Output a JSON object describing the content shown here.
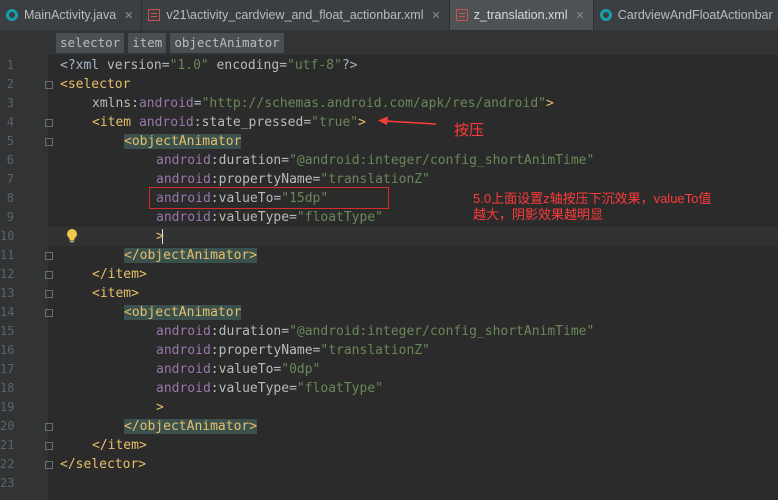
{
  "tabs": [
    {
      "label": "MainActivity.java",
      "icon": "java-class-icon",
      "active": false
    },
    {
      "label": "v21\\activity_cardview_and_float_actionbar.xml",
      "icon": "xml-file-icon",
      "active": false
    },
    {
      "label": "z_translation.xml",
      "icon": "xml-file-icon",
      "active": true
    },
    {
      "label": "CardviewAndFloatActionbar",
      "icon": "java-class-icon",
      "active": false
    }
  ],
  "breadcrumbs": [
    "selector",
    "item",
    "objectAnimator"
  ],
  "line_numbers": [
    "1",
    "2",
    "3",
    "4",
    "5",
    "6",
    "7",
    "8",
    "9",
    "10",
    "11",
    "12",
    "13",
    "14",
    "15",
    "16",
    "17",
    "18",
    "19",
    "20",
    "21",
    "22",
    "23"
  ],
  "code": {
    "l1": {
      "a": "<?xml ",
      "b": "version",
      "c": "=",
      "d": "\"1.0\"",
      "e": " encoding",
      "f": "=",
      "g": "\"utf-8\"",
      "h": "?>"
    },
    "l2": {
      "a": "<selector"
    },
    "l3": {
      "a": "xmlns:",
      "b": "android",
      "c": "=",
      "d": "\"http://schemas.android.com/apk/res/android\"",
      "e": ">"
    },
    "l4": {
      "a": "<item ",
      "b": "android",
      "c": ":state_pressed=",
      "d": "\"true\"",
      "e": ">"
    },
    "l5": {
      "a": "<objectAnimator"
    },
    "l6": {
      "a": "android",
      "b": ":duration=",
      "c": "\"@android:integer/config_shortAnimTime\""
    },
    "l7": {
      "a": "android",
      "b": ":propertyName=",
      "c": "\"translationZ\""
    },
    "l8": {
      "a": "android",
      "b": ":valueTo=",
      "c": "\"15dp\""
    },
    "l9": {
      "a": "android",
      "b": ":valueType=",
      "c": "\"floatType\""
    },
    "l10": {
      "a": ">"
    },
    "l11": {
      "a": "</objectAnimator>"
    },
    "l12": {
      "a": "</item>"
    },
    "l13": {
      "a": "<item>"
    },
    "l14": {
      "a": "<objectAnimator"
    },
    "l15": {
      "a": "android",
      "b": ":duration=",
      "c": "\"@android:integer/config_shortAnimTime\""
    },
    "l16": {
      "a": "android",
      "b": ":propertyName=",
      "c": "\"translationZ\""
    },
    "l17": {
      "a": "android",
      "b": ":valueTo=",
      "c": "\"0dp\""
    },
    "l18": {
      "a": "android",
      "b": ":valueType=",
      "c": "\"floatType\""
    },
    "l19": {
      "a": ">"
    },
    "l20": {
      "a": "</objectAnimator>"
    },
    "l21": {
      "a": "</item>"
    },
    "l22": {
      "a": "</selector>"
    }
  },
  "annotations": {
    "pressed_label": "按压",
    "note_line1": "5.0上面设置z轴按压下沉效果，valueTo值",
    "note_line2": "越大，阴影效果越明显"
  },
  "colors": {
    "editor_bg": "#2b2b2b",
    "tag": "#e8bf6a",
    "attribute_namespace": "#9876aa",
    "string_value": "#6a8759",
    "annotation_red": "#ff3b3b"
  }
}
